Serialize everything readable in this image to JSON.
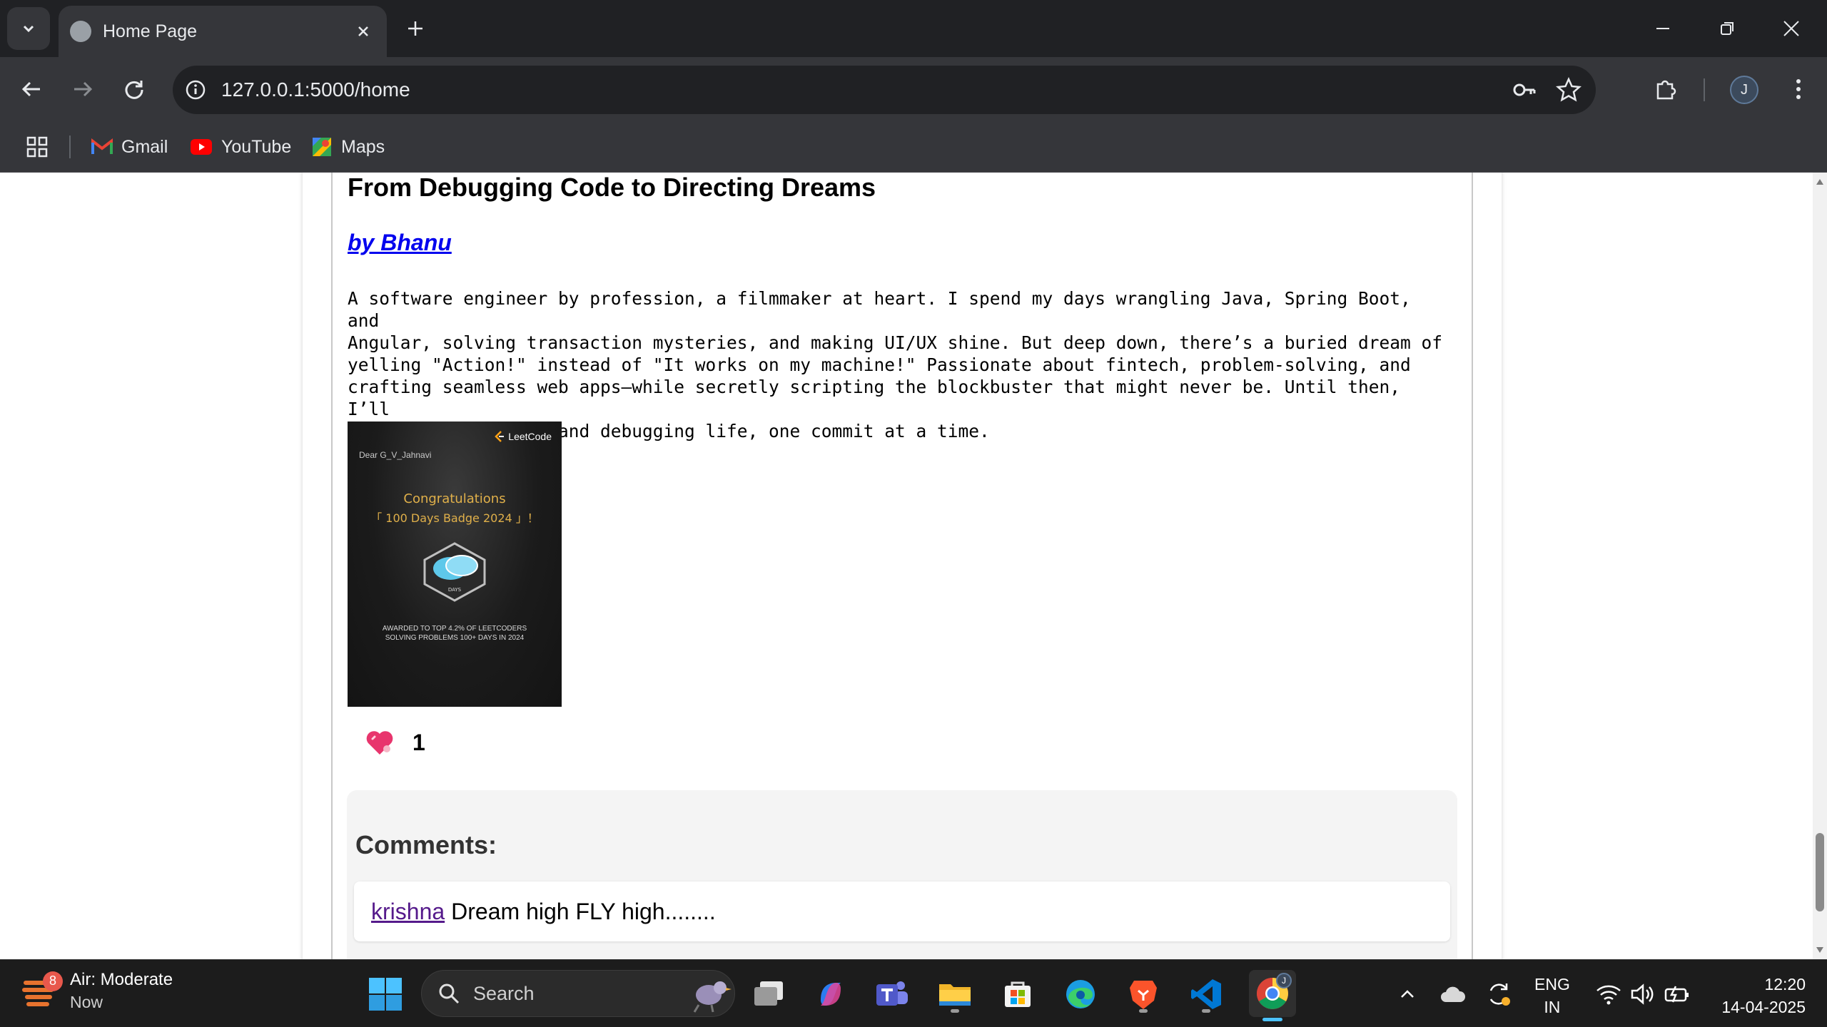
{
  "browser": {
    "tab": {
      "title": "Home Page"
    },
    "url": "127.0.0.1:5000/home",
    "profile_initial": "J",
    "bookmarks": [
      {
        "label": "Gmail",
        "icon": "gmail-icon"
      },
      {
        "label": "YouTube",
        "icon": "youtube-icon"
      },
      {
        "label": "Maps",
        "icon": "maps-icon"
      }
    ]
  },
  "post": {
    "title": "From Debugging Code to Directing Dreams",
    "author": "by Bhanu",
    "body": "A software engineer by profession, a filmmaker at heart. I spend my days wrangling Java, Spring Boot, and\nAngular, solving transaction mysteries, and making UI/UX shine. But deep down, there’s a buried dream of\nyelling \"Action!\" instead of \"It works on my machine!\" Passionate about fintech, problem-solving, and\ncrafting seamless web apps—while secretly scripting the blockbuster that might never be. Until then, I’ll\nkeep directing APIs and debugging life, one commit at a time.",
    "image": {
      "brand": "LeetCode",
      "dear": "Dear G_V_Jahnavi",
      "congrats": "Congratulations",
      "badge_name": "「 100 Days Badge 2024 」！",
      "award_line1": "AWARDED TO TOP 4.2% OF LEETCODERS",
      "award_line2": "SOLVING PROBLEMS 100+ DAYS IN 2024",
      "gem_label": "DAYS"
    },
    "likes": "1"
  },
  "comments": {
    "heading": "Comments:",
    "items": [
      {
        "user": "krishna",
        "text": "Dream high FLY high........"
      }
    ]
  },
  "taskbar": {
    "weather": {
      "badge": "8",
      "title": "Air: Moderate",
      "sub": "Now"
    },
    "search_placeholder": "Search",
    "lang_line1": "ENG",
    "lang_line2": "IN",
    "time": "12:20",
    "date": "14-04-2025",
    "chrome_badge": "J"
  },
  "colors": {
    "link": "#0000ee",
    "visited_link": "#551a8b",
    "like_heart": "#e8356d",
    "taskbar_accent": "#4cc2ff"
  }
}
